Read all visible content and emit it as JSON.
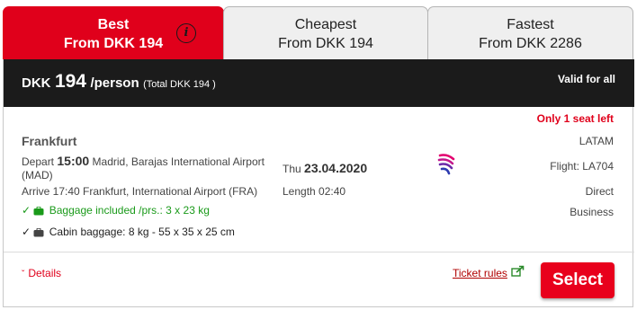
{
  "tabs": [
    {
      "title": "Best",
      "price": "From DKK 194"
    },
    {
      "title": "Cheapest",
      "price": "From DKK 194"
    },
    {
      "title": "Fastest",
      "price": "From DKK 2286"
    }
  ],
  "tab_info_icon": "info-icon",
  "price_bar": {
    "currency": "DKK",
    "amount": "194",
    "per": "/person",
    "total": "(Total DKK 194 )",
    "valid": "Valid for all"
  },
  "flight": {
    "seats_left": "Only 1 seat left",
    "destination": "Frankfurt",
    "depart_label": "Depart",
    "depart_time": "15:00",
    "depart_airport": "Madrid, Barajas International Airport (MAD)",
    "arrive": "Arrive 17:40 Frankfurt, International Airport (FRA)",
    "baggage": "Baggage included /prs.: 3 x 23 kg",
    "cabin_baggage": "Cabin baggage: 8 kg - 55 x 35 x 25 cm",
    "day": "Thu",
    "date": "23.04.2020",
    "length": "Length 02:40",
    "airline": "LATAM",
    "flight_no": "Flight: LA704",
    "stops": "Direct",
    "cabin_class": "Business"
  },
  "footer": {
    "details": "Details",
    "ticket_rules": "Ticket rules",
    "select": "Select"
  },
  "colors": {
    "accent": "#e0001b",
    "bar": "#1b1b1b",
    "baggage_green": "#1a9a1a"
  }
}
